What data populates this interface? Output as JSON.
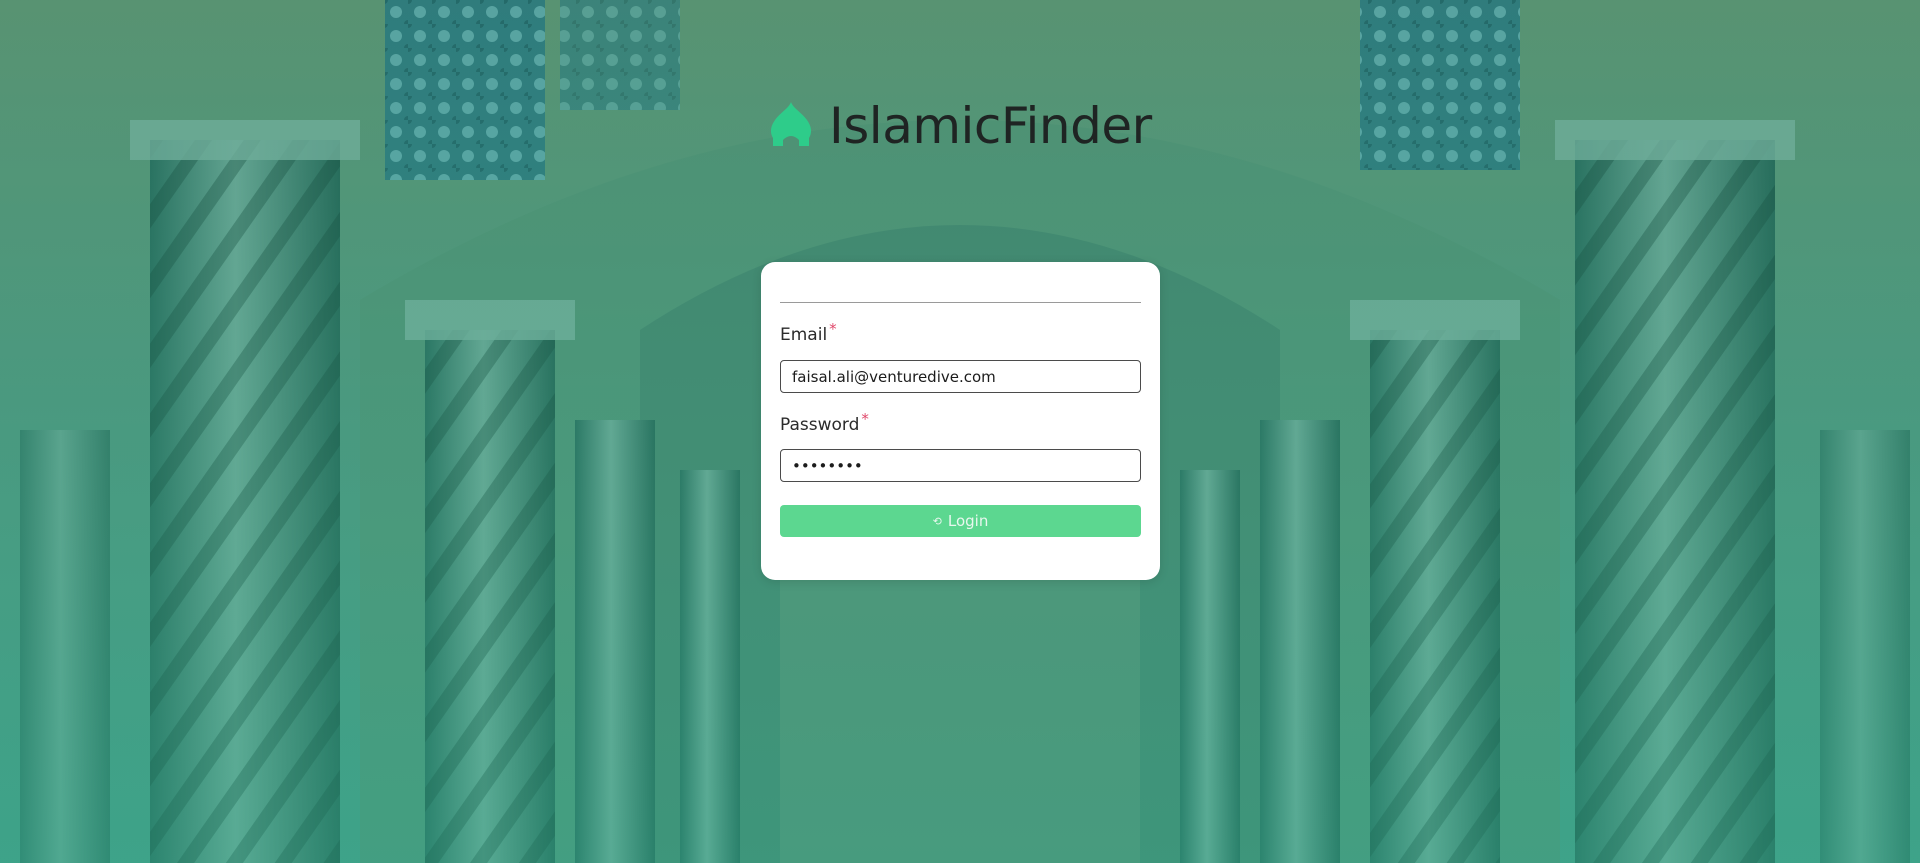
{
  "brand": {
    "name": "IslamicFinder",
    "icon": "mosque-dome-icon",
    "accent": "#2ecc8a"
  },
  "form": {
    "email": {
      "label": "Email",
      "required_mark": "*",
      "value": "faisal.ali@venturedive.com"
    },
    "password": {
      "label": "Password",
      "required_mark": "*",
      "value": "••••••••"
    },
    "login": {
      "label": "Login",
      "icon": "loading-spinner-icon",
      "color": "#5cd790"
    }
  },
  "colors": {
    "required": "#e0496b",
    "overlay": "#3f8f73"
  }
}
